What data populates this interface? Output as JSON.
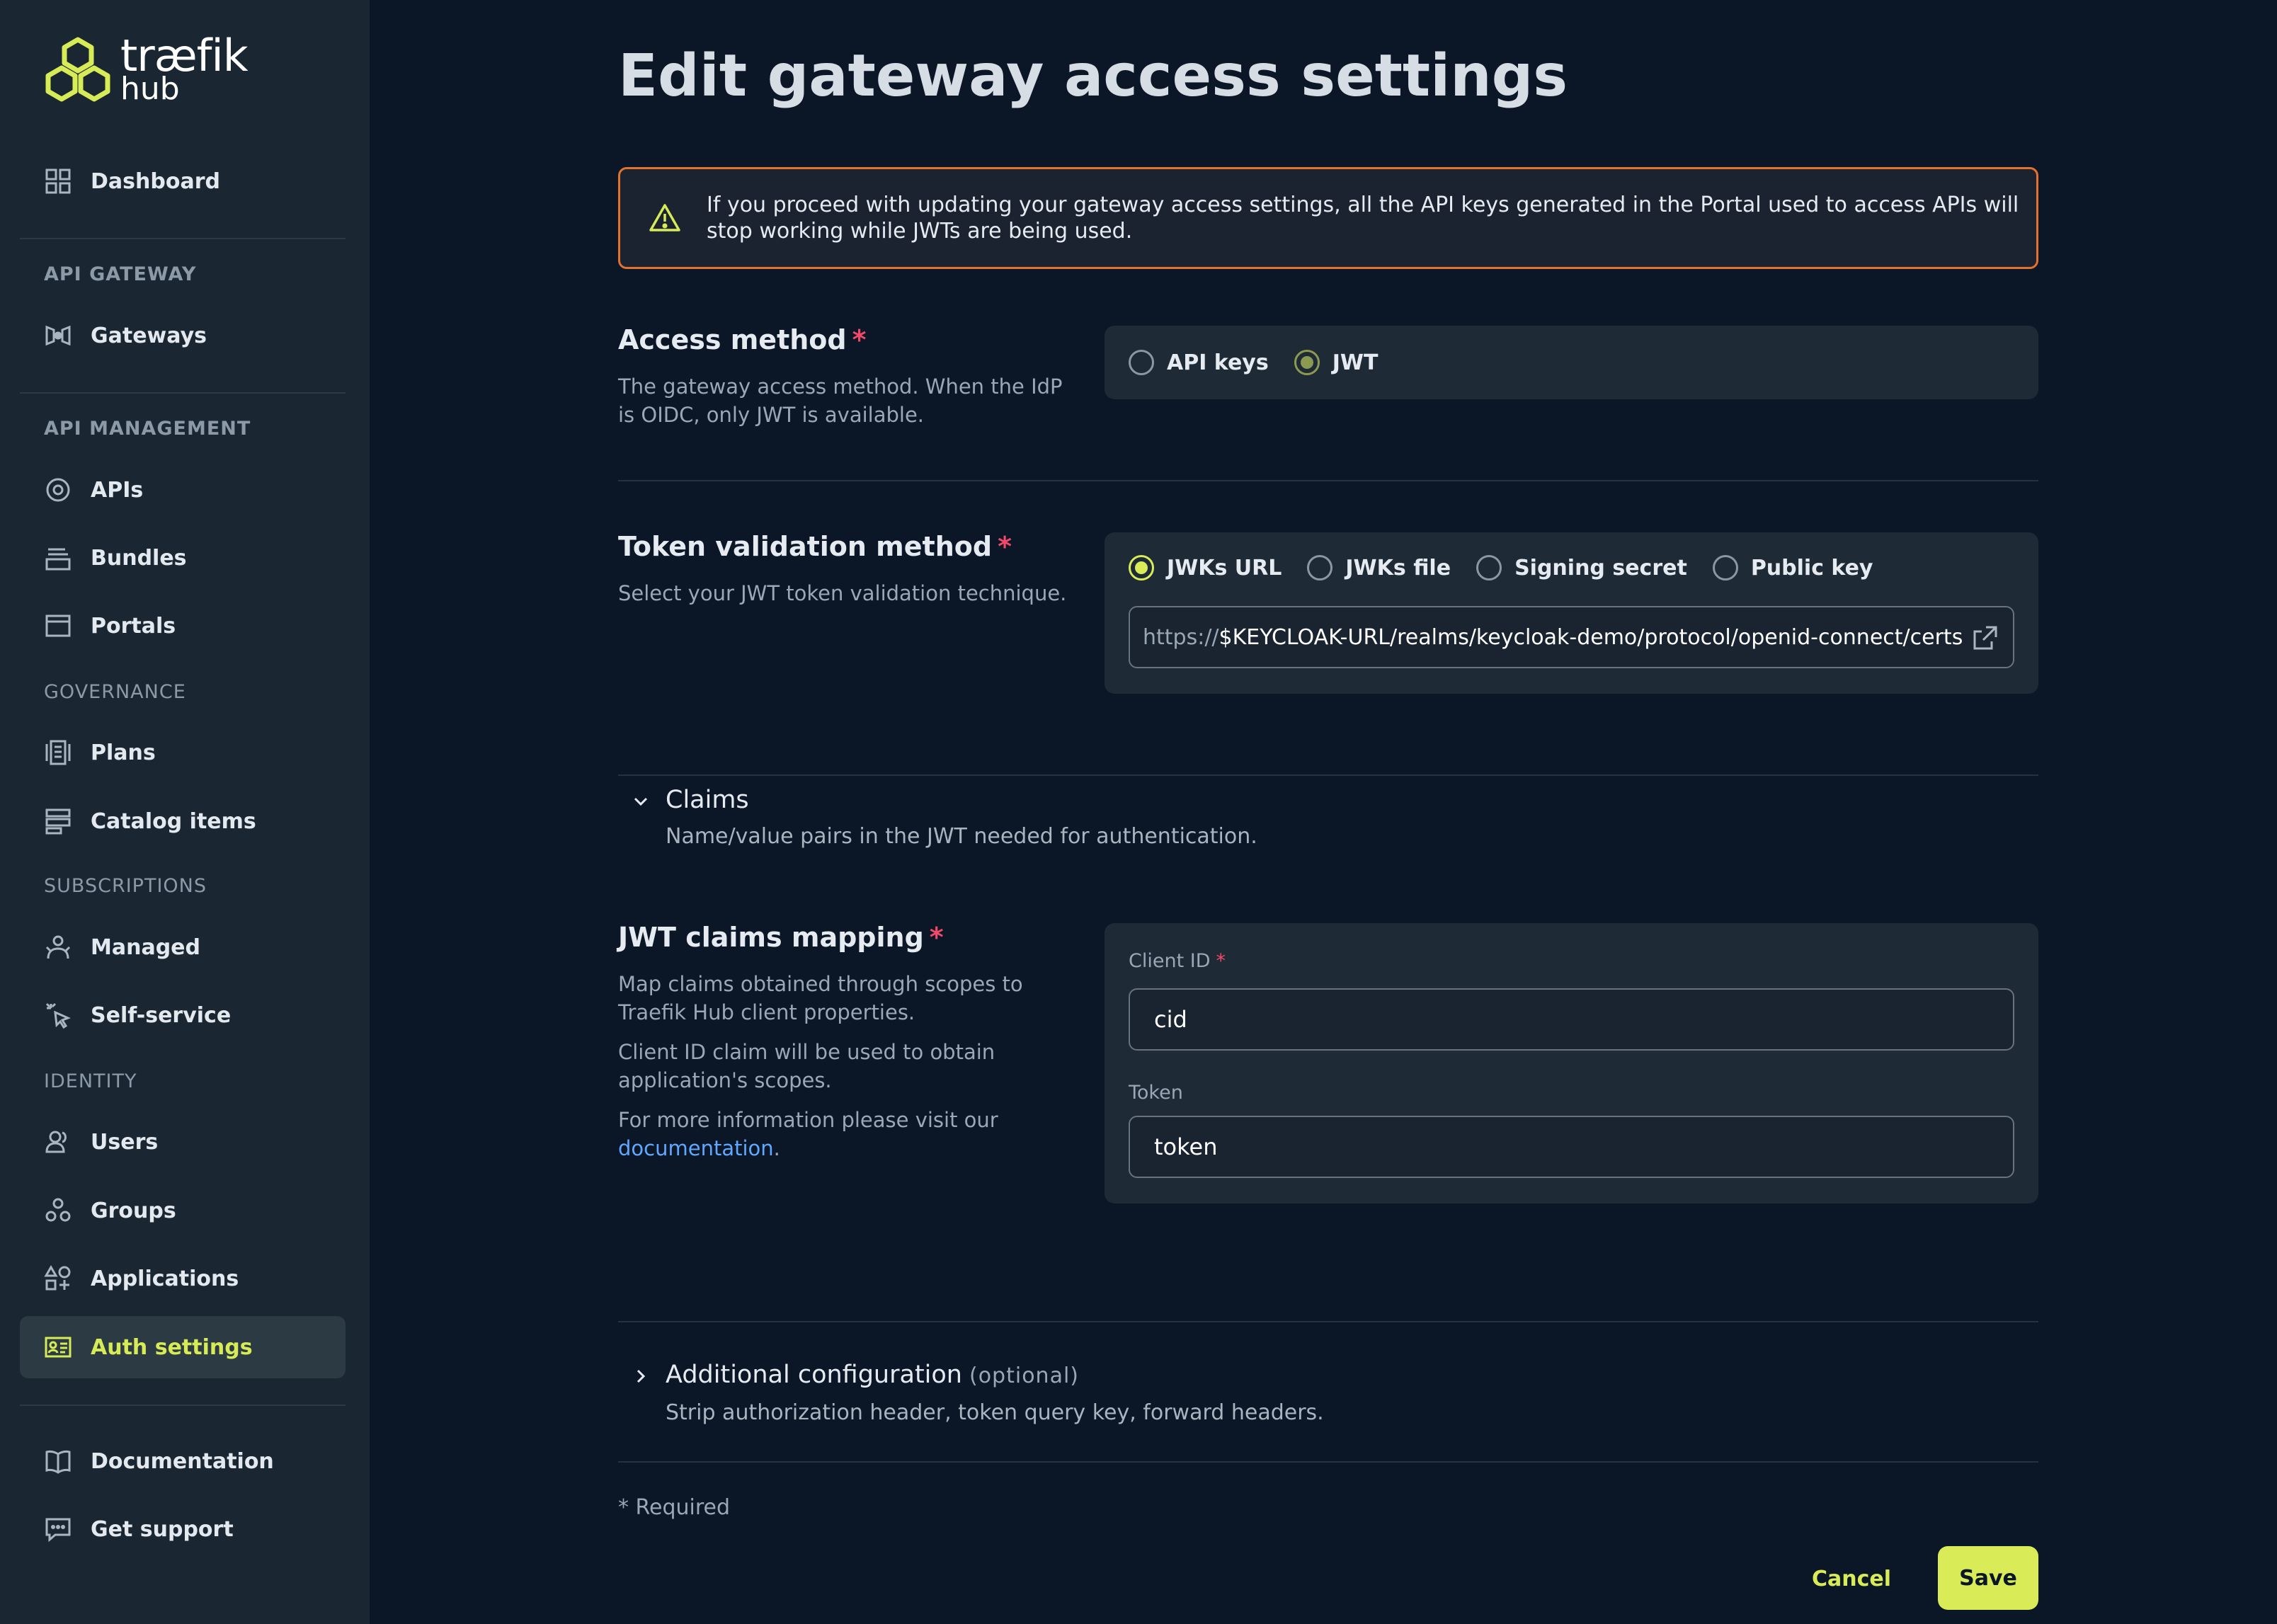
{
  "logo": {
    "line1": "træfik",
    "line2": "hub"
  },
  "sidebar": {
    "dashboard": "Dashboard",
    "sections": {
      "api_gateway": "API GATEWAY",
      "api_management": "API MANAGEMENT",
      "governance": "GOVERNANCE",
      "subscriptions": "SUBSCRIPTIONS",
      "identity": "IDENTITY"
    },
    "items": {
      "gateways": "Gateways",
      "apis": "APIs",
      "bundles": "Bundles",
      "portals": "Portals",
      "plans": "Plans",
      "catalog_items": "Catalog items",
      "managed": "Managed",
      "self_service": "Self-service",
      "users": "Users",
      "groups": "Groups",
      "applications": "Applications",
      "auth_settings": "Auth settings",
      "documentation": "Documentation",
      "get_support": "Get support"
    },
    "active": "Auth settings",
    "accent_color": "#d6eb56"
  },
  "page": {
    "title": "Edit gateway access settings",
    "warning": "If you proceed with updating your gateway access settings, all the API keys generated in the Portal used to access APIs will stop working while JWTs are being used.",
    "access_method": {
      "title": "Access method",
      "required_mark": "*",
      "description": "The gateway access method. When the IdP is OIDC, only JWT is available.",
      "options": [
        "API keys",
        "JWT"
      ],
      "selected": "JWT"
    },
    "token_validation": {
      "title": "Token validation method",
      "required_mark": "*",
      "description": "Select your JWT token validation technique.",
      "options": [
        "JWKs URL",
        "JWKs file",
        "Signing secret",
        "Public key"
      ],
      "selected": "JWKs URL",
      "url_prefix": "https://",
      "url_value": "$KEYCLOAK-URL/realms/keycloak-demo/protocol/openid-connect/certs"
    },
    "claims": {
      "title": "Claims",
      "description": "Name/value pairs in the JWT needed for authentication.",
      "expanded": true
    },
    "jwt_claims_mapping": {
      "title": "JWT claims mapping",
      "required_mark": "*",
      "desc1": "Map claims obtained through scopes to Traefik Hub client properties.",
      "desc2": "Client ID claim will be used to obtain application's scopes.",
      "desc3": "For more information please visit our",
      "link": "documentation",
      "period": ".",
      "client_id_label": "Client ID",
      "client_id_value": "cid",
      "token_label": "Token",
      "token_value": "token"
    },
    "additional_config": {
      "title": "Additional configuration",
      "optional": "(optional)",
      "description": "Strip authorization header, token query key, forward headers.",
      "expanded": false
    },
    "required_note": "* Required",
    "cancel": "Cancel",
    "save": "Save"
  }
}
